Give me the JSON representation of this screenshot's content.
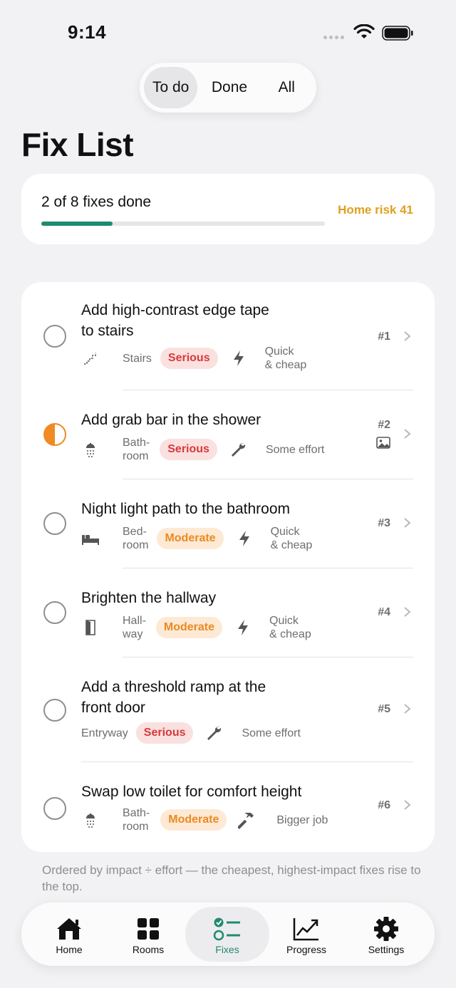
{
  "status_bar": {
    "time": "9:14"
  },
  "segmented": {
    "items": [
      "To do",
      "Done",
      "All"
    ],
    "selected": "To do"
  },
  "page_title": "Fix List",
  "progress": {
    "text": "2 of 8 fixes done",
    "fraction": 0.25,
    "risk_label": "Home risk 41",
    "bar_color": "#1f8a70",
    "risk_color": "#e0a020"
  },
  "fixes": [
    {
      "title": "Add high-contrast edge tape to stairs",
      "room": "Stairs",
      "room_icon": "stairs-icon",
      "severity": "Serious",
      "effort_icon": "bolt-icon",
      "effort": "Quick & cheap",
      "rank": "#1",
      "status": "todo"
    },
    {
      "title": "Add grab bar in the shower",
      "room": "Bath-room",
      "room_icon": "shower-icon",
      "severity": "Serious",
      "effort_icon": "wrench-icon",
      "effort": "Some effort",
      "rank": "#2",
      "status": "in-progress",
      "has_photo": true
    },
    {
      "title": "Night light path to the bathroom",
      "room": "Bed-room",
      "room_icon": "bed-icon",
      "severity": "Moderate",
      "effort_icon": "bolt-icon",
      "effort": "Quick & cheap",
      "rank": "#3",
      "status": "todo"
    },
    {
      "title": "Brighten the hallway",
      "room": "Hall-way",
      "room_icon": "door-icon",
      "severity": "Moderate",
      "effort_icon": "bolt-icon",
      "effort": "Quick & cheap",
      "rank": "#4",
      "status": "todo"
    },
    {
      "title": "Add a threshold ramp at the front door",
      "room": "Entryway",
      "room_icon": "",
      "severity": "Serious",
      "effort_icon": "wrench-icon",
      "effort": "Some effort",
      "rank": "#5",
      "status": "todo"
    },
    {
      "title": "Swap low toilet for comfort height",
      "room": "Bath-room",
      "room_icon": "shower-icon",
      "severity": "Moderate",
      "effort_icon": "hammer-icon",
      "effort": "Bigger job",
      "rank": "#6",
      "status": "todo"
    }
  ],
  "fix_text": {
    "f1_title_a": "Add high-contrast edge tape",
    "f1_title_b": "to stairs",
    "f1_room": "Stairs",
    "f1_effort_a": "Quick",
    "f1_effort_b": "& cheap",
    "f2_room_a": "Bath-",
    "f2_room_b": "room",
    "f3_room_a": "Bed-",
    "f3_room_b": "room",
    "f3_effort_a": "Quick",
    "f3_effort_b": "& cheap",
    "f4_room_a": "Hall-",
    "f4_room_b": "way",
    "f4_effort_a": "Quick",
    "f4_effort_b": "& cheap",
    "f5_title_a": "Add a threshold ramp at the",
    "f5_title_b": "front door",
    "f6_room_a": "Bath-",
    "f6_room_b": "room"
  },
  "footnote": "Ordered by impact ÷ effort — the cheapest, highest-impact fixes rise to the top.",
  "tabs": [
    {
      "label": "Home",
      "icon": "house-icon"
    },
    {
      "label": "Rooms",
      "icon": "grid-icon"
    },
    {
      "label": "Fixes",
      "icon": "checklist-icon",
      "active": true
    },
    {
      "label": "Progress",
      "icon": "chart-icon"
    },
    {
      "label": "Settings",
      "icon": "gear-icon"
    }
  ],
  "colors": {
    "serious_bg": "#fbe0e0",
    "serious_text": "#d63a3a",
    "moderate_bg": "#fde9d4",
    "moderate_text": "#ea8a22",
    "in_progress": "#f08a24"
  }
}
